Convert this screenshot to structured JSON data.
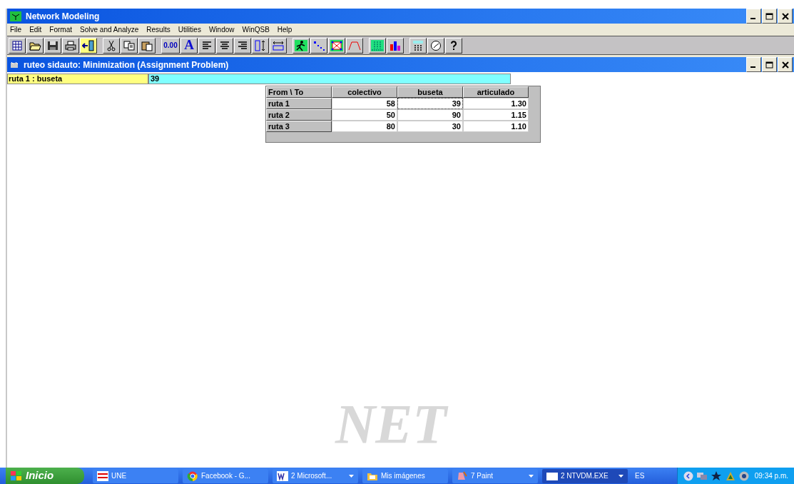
{
  "window": {
    "title": "Network Modeling"
  },
  "menu": [
    "File",
    "Edit",
    "Format",
    "Solve and Analyze",
    "Results",
    "Utilities",
    "Window",
    "WinQSB",
    "Help"
  ],
  "toolbar": [
    {
      "kind": "grid"
    },
    {
      "kind": "open"
    },
    {
      "kind": "save"
    },
    {
      "kind": "print"
    },
    {
      "kind": "exit",
      "selected": true
    },
    {
      "kind": "sep"
    },
    {
      "kind": "cut"
    },
    {
      "kind": "copy"
    },
    {
      "kind": "paste"
    },
    {
      "kind": "sep"
    },
    {
      "kind": "text",
      "label": "0.00"
    },
    {
      "kind": "bigtext",
      "label": "A"
    },
    {
      "kind": "alignleft"
    },
    {
      "kind": "aligncenter"
    },
    {
      "kind": "alignright"
    },
    {
      "kind": "colwidth"
    },
    {
      "kind": "rowheight"
    },
    {
      "kind": "sep"
    },
    {
      "kind": "run"
    },
    {
      "kind": "nodes"
    },
    {
      "kind": "network"
    },
    {
      "kind": "trapezoid"
    },
    {
      "kind": "sep"
    },
    {
      "kind": "matrix"
    },
    {
      "kind": "bars"
    },
    {
      "kind": "sep"
    },
    {
      "kind": "calculator"
    },
    {
      "kind": "clock"
    },
    {
      "kind": "help"
    }
  ],
  "document": {
    "title": "ruteo sidauto: Minimization (Assignment Problem)"
  },
  "cell_editor": {
    "cell": "ruta 1 : buseta",
    "value": "39"
  },
  "table": {
    "columns": [
      "From \\ To",
      "colectivo",
      "buseta",
      "articulado"
    ],
    "rows": [
      {
        "label": "ruta 1",
        "cells": [
          {
            "value": "58",
            "selected": false
          },
          {
            "value": "39",
            "selected": true
          },
          {
            "value": "1.30",
            "selected": false
          }
        ]
      },
      {
        "label": "ruta 2",
        "cells": [
          {
            "value": "50",
            "selected": false
          },
          {
            "value": "90",
            "selected": false
          },
          {
            "value": "1.15",
            "selected": false
          }
        ]
      },
      {
        "label": "ruta 3",
        "cells": [
          {
            "value": "80",
            "selected": false
          },
          {
            "value": "30",
            "selected": false
          },
          {
            "value": "1.10",
            "selected": false
          }
        ]
      }
    ]
  },
  "logo": "NET",
  "taskbar": {
    "start": "Inicio",
    "items": [
      {
        "label": "UNE",
        "kind": "une",
        "group": false,
        "selected": false
      },
      {
        "label": "Facebook - G...",
        "kind": "browser",
        "group": false,
        "selected": false
      },
      {
        "label": "2 Microsoft...",
        "kind": "word",
        "group": true,
        "selected": false
      },
      {
        "label": "Mis imágenes",
        "kind": "folder",
        "group": false,
        "selected": false
      },
      {
        "label": "7 Paint",
        "kind": "paint",
        "group": true,
        "selected": false
      },
      {
        "label": "2 NTVDM.EXE",
        "kind": "console",
        "group": true,
        "selected": true
      }
    ],
    "language": "ES",
    "clock": "09:34 p.m."
  }
}
